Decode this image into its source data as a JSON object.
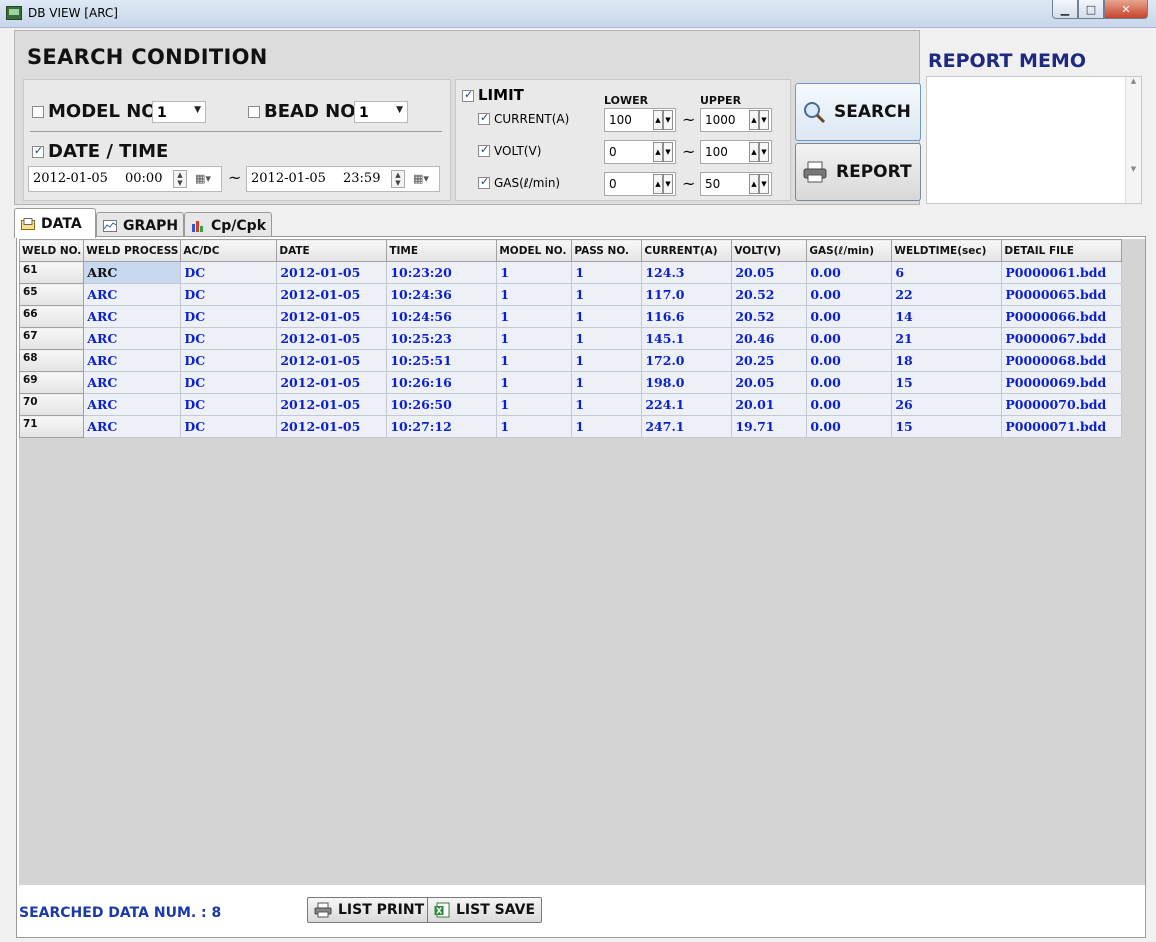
{
  "window": {
    "title": "DB VIEW [ARC]"
  },
  "search": {
    "title": "SEARCH CONDITION",
    "model": {
      "label": "MODEL NO.",
      "value": "1",
      "checked": false
    },
    "bead": {
      "label": "BEAD NO.",
      "value": "1",
      "checked": false
    },
    "datetime": {
      "label": "DATE / TIME",
      "checked": true,
      "from_date": "2012-01-05",
      "from_time": "00:00",
      "to_date": "2012-01-05",
      "to_time": "23:59",
      "tilde": "~"
    },
    "limit": {
      "label": "LIMIT",
      "checked": true,
      "lower_header": "LOWER",
      "upper_header": "UPPER",
      "tilde": "~",
      "rows": [
        {
          "label": "CURRENT(A)",
          "lower": "100",
          "upper": "1000",
          "checked": true
        },
        {
          "label": "VOLT(V)",
          "lower": "0",
          "upper": "100",
          "checked": true
        },
        {
          "label": "GAS(ℓ/min)",
          "lower": "0",
          "upper": "50",
          "checked": true
        }
      ]
    },
    "search_button": "SEARCH",
    "report_button": "REPORT"
  },
  "memo": {
    "title": "REPORT MEMO",
    "value": ""
  },
  "tabs": [
    {
      "label": "DATA",
      "icon": "data-icon",
      "active": true
    },
    {
      "label": "GRAPH",
      "icon": "graph-icon",
      "active": false
    },
    {
      "label": "Cp/Cpk",
      "icon": "bar-chart-icon",
      "active": false
    }
  ],
  "table": {
    "columns": [
      "WELD NO.",
      "WELD PROCESS",
      "AC/DC",
      "DATE",
      "TIME",
      "MODEL NO.",
      "PASS NO.",
      "CURRENT(A)",
      "VOLT(V)",
      "GAS(ℓ/min)",
      "WELDTIME(sec)",
      "DETAIL FILE"
    ],
    "rows": [
      {
        "no": "61",
        "cells": [
          "ARC",
          "DC",
          "2012-01-05",
          "10:23:20",
          "1",
          "1",
          "124.3",
          "20.05",
          "0.00",
          "6",
          "P0000061.bdd"
        ]
      },
      {
        "no": "65",
        "cells": [
          "ARC",
          "DC",
          "2012-01-05",
          "10:24:36",
          "1",
          "1",
          "117.0",
          "20.52",
          "0.00",
          "22",
          "P0000065.bdd"
        ]
      },
      {
        "no": "66",
        "cells": [
          "ARC",
          "DC",
          "2012-01-05",
          "10:24:56",
          "1",
          "1",
          "116.6",
          "20.52",
          "0.00",
          "14",
          "P0000066.bdd"
        ]
      },
      {
        "no": "67",
        "cells": [
          "ARC",
          "DC",
          "2012-01-05",
          "10:25:23",
          "1",
          "1",
          "145.1",
          "20.46",
          "0.00",
          "21",
          "P0000067.bdd"
        ]
      },
      {
        "no": "68",
        "cells": [
          "ARC",
          "DC",
          "2012-01-05",
          "10:25:51",
          "1",
          "1",
          "172.0",
          "20.25",
          "0.00",
          "18",
          "P0000068.bdd"
        ]
      },
      {
        "no": "69",
        "cells": [
          "ARC",
          "DC",
          "2012-01-05",
          "10:26:16",
          "1",
          "1",
          "198.0",
          "20.05",
          "0.00",
          "15",
          "P0000069.bdd"
        ]
      },
      {
        "no": "70",
        "cells": [
          "ARC",
          "DC",
          "2012-01-05",
          "10:26:50",
          "1",
          "1",
          "224.1",
          "20.01",
          "0.00",
          "26",
          "P0000070.bdd"
        ]
      },
      {
        "no": "71",
        "cells": [
          "ARC",
          "DC",
          "2012-01-05",
          "10:27:12",
          "1",
          "1",
          "247.1",
          "19.71",
          "0.00",
          "15",
          "P0000071.bdd"
        ]
      }
    ]
  },
  "footer": {
    "count_text": "SEARCHED DATA NUM. : 8",
    "list_print": "LIST PRINT",
    "list_save": "LIST SAVE"
  }
}
